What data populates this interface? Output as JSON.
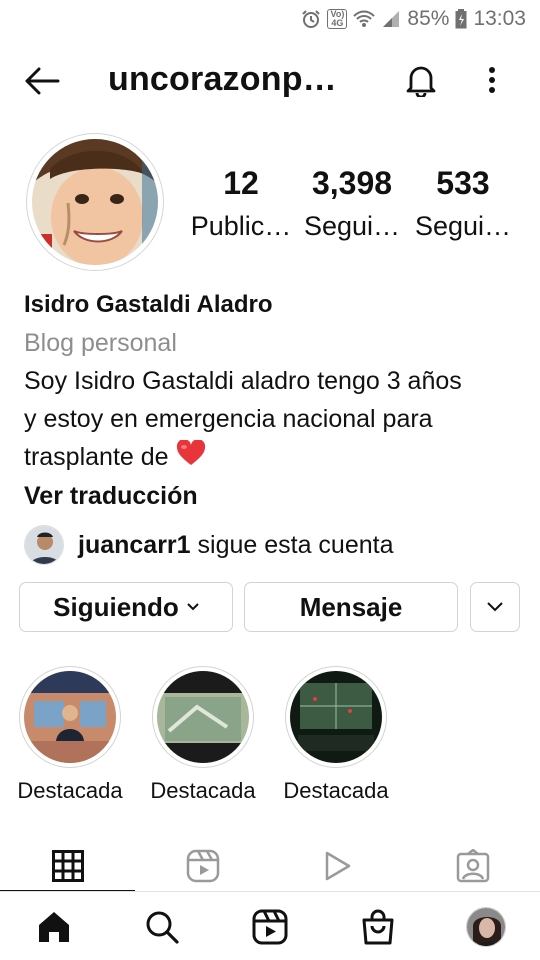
{
  "status_bar": {
    "battery": "85%",
    "time": "13:03",
    "volte_top": "Vo)",
    "volte_bottom": "4G",
    "icons": [
      "alarm-icon",
      "volte-icon",
      "wifi-icon",
      "signal-icon",
      "battery-icon"
    ]
  },
  "header": {
    "username": "uncorazonp…",
    "icons": [
      "back-arrow-icon",
      "bell-icon",
      "more-vertical-icon"
    ]
  },
  "profile": {
    "stats": [
      {
        "value": "12",
        "label": "Public…"
      },
      {
        "value": "3,398",
        "label": "Segui…"
      },
      {
        "value": "533",
        "label": "Segui…"
      }
    ],
    "name": "Isidro Gastaldi Aladro",
    "category": "Blog personal",
    "bio_line1": "Soy Isidro Gastaldi aladro tengo 3 años",
    "bio_line2": "y estoy en emergencia nacional para",
    "bio_line3": "trasplante de ",
    "translate": "Ver traducción",
    "followed_by_user": "juancarr1",
    "followed_by_text": "sigue esta cuenta"
  },
  "buttons": {
    "following": "Siguiendo",
    "message": "Mensaje"
  },
  "highlights": [
    {
      "label": "Destacada"
    },
    {
      "label": "Destacada"
    },
    {
      "label": "Destacada"
    }
  ],
  "tabs": [
    "grid-icon",
    "reels-icon",
    "igtv-play-icon",
    "tagged-icon"
  ],
  "bottom_nav": [
    "home-icon",
    "search-icon",
    "reels-icon",
    "shop-icon",
    "profile-avatar"
  ],
  "colors": {
    "secondary_text": "#8e8e8e",
    "heart": "#e8343b",
    "border": "#d3d3d3"
  }
}
